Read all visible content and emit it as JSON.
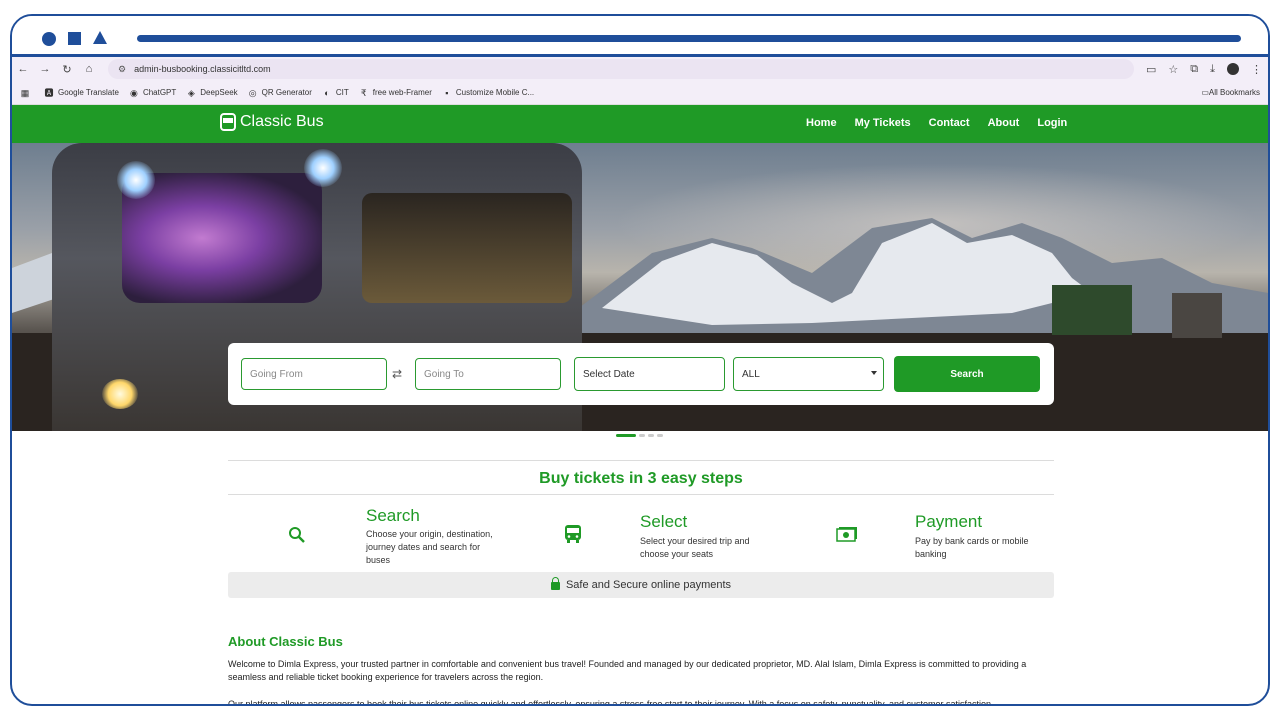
{
  "browser": {
    "url": "admin-busbooking.classicitltd.com",
    "bookmarks": [
      "Google Translate",
      "ChatGPT",
      "DeepSeek",
      "QR Generator",
      "CIT",
      "free web-Framer",
      "Customize Mobile C..."
    ],
    "all_bookmarks": "All Bookmarks"
  },
  "site": {
    "brand": "Classic Bus",
    "menu": [
      "Home",
      "My Tickets",
      "Contact",
      "About",
      "Login"
    ]
  },
  "search": {
    "from_placeholder": "Going From",
    "to_placeholder": "Going To",
    "date_label": "Select Date",
    "type_value": "ALL",
    "button": "Search"
  },
  "steps": {
    "title": "Buy tickets in 3 easy steps",
    "items": [
      {
        "title": "Search",
        "desc": "Choose your origin, destination, journey dates and search for buses",
        "icon": "search-icon"
      },
      {
        "title": "Select",
        "desc": "Select your desired trip and choose your seats",
        "icon": "bus-icon"
      },
      {
        "title": "Payment",
        "desc": "Pay by bank cards or mobile banking",
        "icon": "payment-icon"
      }
    ],
    "secure": "Safe and Secure online payments"
  },
  "about": {
    "title": "About Classic Bus",
    "text": "Welcome to Dimla Express, your trusted partner in comfortable and convenient bus travel! Founded and managed by our dedicated proprietor, MD. Alal Islam, Dimla Express is committed to providing a seamless and reliable ticket booking experience for travelers across the region.",
    "text2": "Our platform allows passengers to book their bus tickets online quickly and effortlessly, ensuring a stress-free start to their journey. With a focus on safety, punctuality, and customer satisfaction"
  },
  "colors": {
    "brand_green": "#1f9a26",
    "frame_blue": "#1f4e9a"
  }
}
